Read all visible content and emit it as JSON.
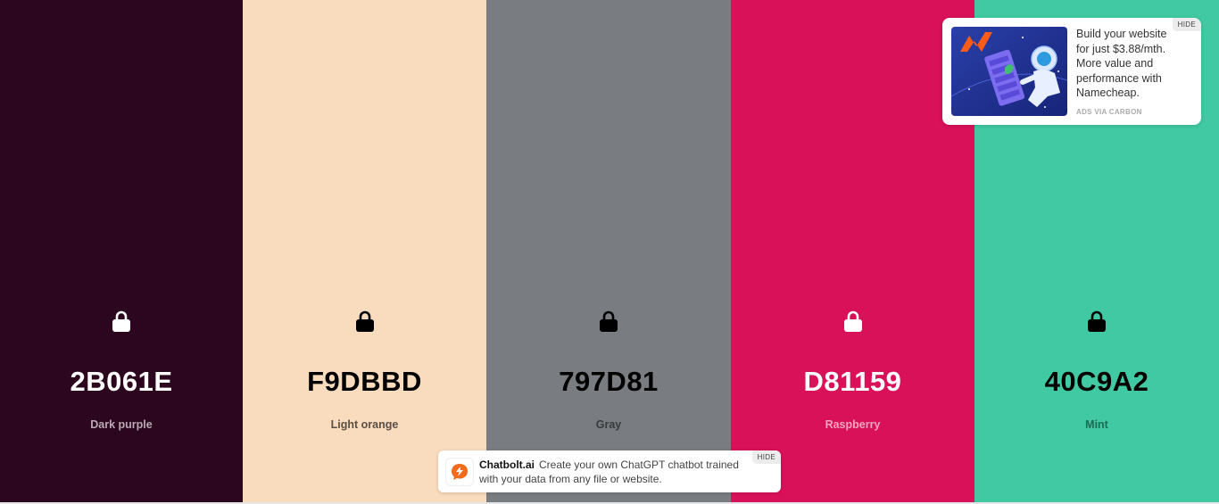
{
  "colors": [
    {
      "hex": "2B061E",
      "name": "Dark purple",
      "bg": "#2B061E",
      "fg": "#ffffff",
      "label": "#b9a9b4"
    },
    {
      "hex": "F9DBBD",
      "name": "Light orange",
      "bg": "#F9DBBD",
      "fg": "#000000",
      "label": "#5a4f45"
    },
    {
      "hex": "797D81",
      "name": "Gray",
      "bg": "#797D81",
      "fg": "#000000",
      "label": "#383a3c"
    },
    {
      "hex": "D81159",
      "name": "Raspberry",
      "bg": "#D81159",
      "fg": "#ffffff",
      "label": "#f3a3bf"
    },
    {
      "hex": "40C9A2",
      "name": "Mint",
      "bg": "#40C9A2",
      "fg": "#000000",
      "label": "#1d6b55"
    }
  ],
  "icons": {
    "lock": "lock-icon"
  },
  "carbon_ad": {
    "text": "Build your website for just $3.88/mth. More value and performance with Namecheap.",
    "via": "ADS VIA CARBON",
    "hide": "HIDE"
  },
  "chat_ad": {
    "brand": "Chatbolt.ai",
    "text": "Create your own ChatGPT chatbot trained with your data from any file or website.",
    "hide": "HIDE"
  }
}
